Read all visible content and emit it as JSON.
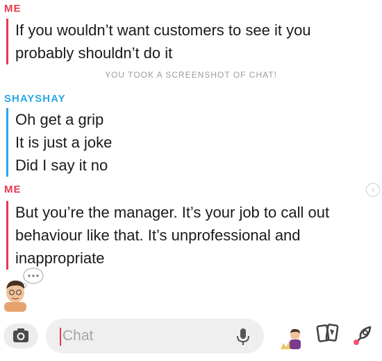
{
  "messages": {
    "first": {
      "sender": "ME",
      "lines": [
        "If you wouldn’t want customers to see it you",
        "probably shouldn’t do it"
      ]
    },
    "system_notice": "YOU TOOK A SCREENSHOT OF CHAT!",
    "second": {
      "sender": "SHAYSHAY",
      "lines": [
        "Oh get a grip",
        "It is just a joke",
        "Did I say it no"
      ]
    },
    "third": {
      "sender": "ME",
      "lines": [
        "But you’re the manager. It’s your job to call out",
        "behaviour like that. It’s unprofessional and",
        "inappropriate"
      ]
    }
  },
  "input_bar": {
    "placeholder": "Chat"
  },
  "icons": {
    "camera": "camera-icon",
    "mic": "microphone-icon",
    "bitmoji": "bitmoji-icon",
    "cards": "cards-icon",
    "rocket": "rocket-icon",
    "chevron": "chevron-right-icon"
  },
  "colors": {
    "me": "#e6394d",
    "them": "#2aa7e6",
    "notice": "#9a9a9a"
  }
}
